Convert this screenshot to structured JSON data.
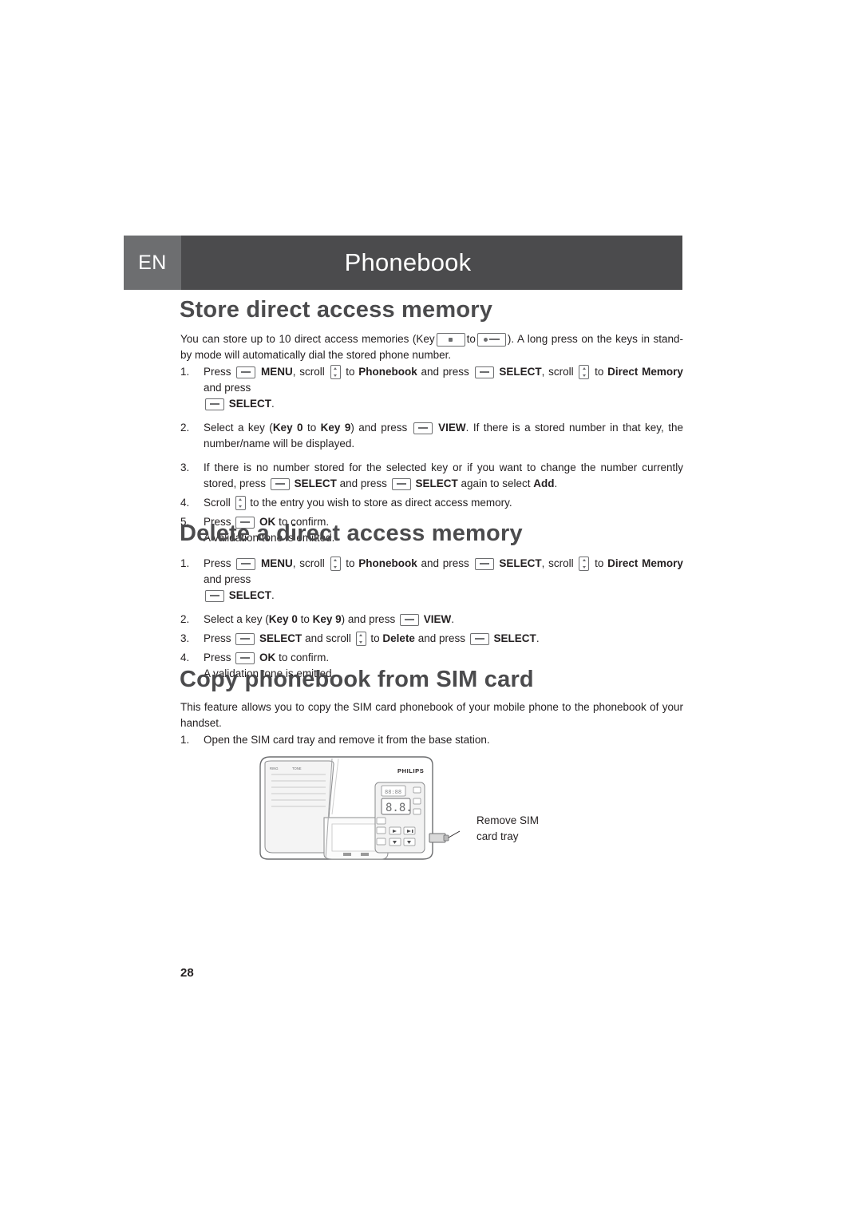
{
  "header": {
    "lang": "EN",
    "title": "Phonebook"
  },
  "sections": {
    "store": {
      "title": "Store direct access memory",
      "intro_a": "You can store up to 10 direct access memories (Key",
      "intro_b": "to",
      "intro_c": "). A long press on the keys in stand-by mode will automatically dial the stored phone number.",
      "steps": [
        {
          "num": "1.",
          "parts": [
            "Press",
            "MENU",
            ", scroll",
            "to",
            "Phonebook",
            "and press",
            "SELECT",
            ", scroll",
            "to",
            "Direct Memory",
            "and press",
            "SELECT",
            "."
          ]
        },
        {
          "num": "2.",
          "parts": [
            "Select a key (",
            "Key 0",
            "to",
            "Key 9",
            ") and press",
            "VIEW",
            ". If there is a stored number in that key, the number/name will be displayed."
          ]
        },
        {
          "num": "3.",
          "parts": [
            "If there is no number stored for the selected key or if you want to change the number currently stored, press",
            "SELECT",
            "and press",
            "SELECT",
            "again to select",
            "Add",
            "."
          ]
        },
        {
          "num": "4.",
          "parts": [
            "Scroll",
            "to the entry you wish to store as direct access memory."
          ]
        },
        {
          "num": "5.",
          "parts": [
            "Press",
            "OK",
            "to confirm.",
            "A validation tone is emitted."
          ]
        }
      ]
    },
    "delete": {
      "title": "Delete a direct access memory",
      "steps": [
        {
          "num": "1.",
          "parts": [
            "Press",
            "MENU",
            ", scroll",
            "to",
            "Phonebook",
            "and press",
            "SELECT",
            ", scroll",
            "to",
            "Direct Memory",
            "and press",
            "SELECT",
            "."
          ]
        },
        {
          "num": "2.",
          "parts": [
            "Select a key (",
            "Key 0",
            "to",
            "Key 9",
            ") and press",
            "VIEW",
            "."
          ]
        },
        {
          "num": "3.",
          "parts": [
            "Press",
            "SELECT",
            "and scroll",
            "to",
            "Delete",
            "and press",
            "SELECT",
            "."
          ]
        },
        {
          "num": "4.",
          "parts": [
            "Press",
            "OK",
            "to confirm.",
            "A validation tone is emitted."
          ]
        }
      ]
    },
    "copy": {
      "title": "Copy phonebook from SIM card",
      "intro": "This feature allows you to copy the SIM card phonebook of your mobile phone to the phonebook of your handset.",
      "step1_num": "1.",
      "step1_text": "Open the SIM card tray and remove it from the base station."
    }
  },
  "figure": {
    "brand": "PHILIPS",
    "display_left": "8888",
    "display_main": "8.8.",
    "left_labels": "RING   TONE",
    "callout_line1": "Remove  SIM",
    "callout_line2": "card tray"
  },
  "page_number": "28"
}
